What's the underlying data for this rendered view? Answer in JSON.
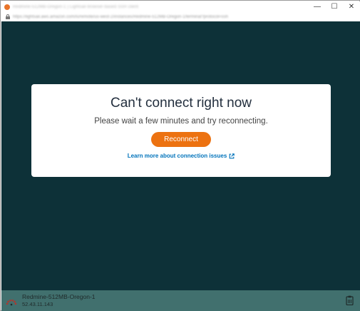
{
  "window": {
    "title": "Redmine-512MB-Oregon-1 | Lightsail browser-based SSH client",
    "minimize_glyph": "—",
    "maximize_glyph": "☐",
    "close_glyph": "✕"
  },
  "address_bar": {
    "url": "https://lightsail.aws.amazon.com/ls/remote/us-west-2/instances/Redmine-512MB-Oregon-1/terminal?protocol=ssh"
  },
  "dialog": {
    "title": "Can't connect right now",
    "message": "Please wait a few minutes and try reconnecting.",
    "reconnect_label": "Reconnect",
    "learn_more_label": "Learn more about connection issues"
  },
  "status_bar": {
    "instance_name": "Redmine-512MB-Oregon-1",
    "instance_ip": "52.43.11.143"
  },
  "colors": {
    "session_background": "#0d3138",
    "status_bar": "#41706e",
    "accent_orange": "#ec7211",
    "link_blue": "#0073bb"
  },
  "icons": {
    "app": "app-icon",
    "lock": "lock-icon",
    "external_link": "external-link-icon",
    "instance": "instance-icon",
    "clipboard": "clipboard-icon"
  }
}
